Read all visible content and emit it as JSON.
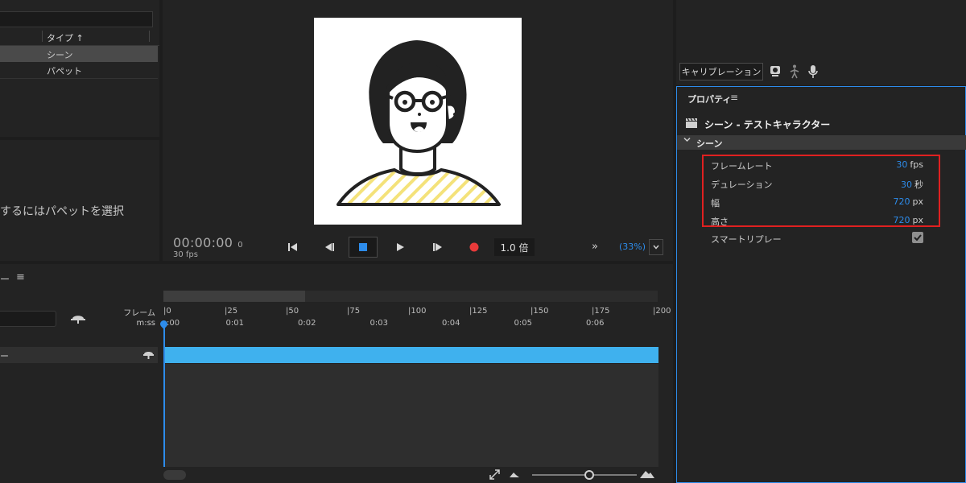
{
  "project": {
    "type_header": "タイプ",
    "sort_arrow": "↑",
    "rows": [
      {
        "label": "シーン",
        "selected": true
      },
      {
        "label": "パペット",
        "selected": false
      }
    ],
    "hint_text": "するにはパペットを選択"
  },
  "preview": {
    "timecode": "00:00:00",
    "timecode_frames": "0",
    "fps_text": "30 fps",
    "speed": "1.0 倍",
    "zoom": "(33%)",
    "more": "»",
    "controls": [
      "skip-back",
      "step-back",
      "stop",
      "play",
      "step-forward",
      "record"
    ]
  },
  "timeline": {
    "title": "ー",
    "frame_label": "フレーム",
    "time_label": "m:ss",
    "frame_ticks": [
      "0",
      "25",
      "50",
      "75",
      "100",
      "125",
      "150",
      "175",
      "200"
    ],
    "time_ticks": [
      ":00",
      "0:01",
      "0:02",
      "0:03",
      "0:04",
      "0:05",
      "0:06"
    ],
    "track_name": "ー"
  },
  "right": {
    "calibration_label": "キャリブレーション"
  },
  "properties": {
    "title": "プロパティ",
    "scene_name": "シーン - テストキャラクター",
    "section_label": "シーン",
    "items": [
      {
        "label": "フレームレート",
        "value": "30",
        "unit": "fps"
      },
      {
        "label": "デュレーション",
        "value": "30",
        "unit": "秒"
      },
      {
        "label": "幅",
        "value": "720",
        "unit": "px"
      },
      {
        "label": "高さ",
        "value": "720",
        "unit": "px"
      }
    ],
    "smart_replay_label": "スマートリプレー",
    "smart_replay_checked": true
  },
  "colors": {
    "accent": "#2d8ceb",
    "clip": "#3fb1ee",
    "highlight": "#e02020",
    "record": "#e83a3a"
  }
}
